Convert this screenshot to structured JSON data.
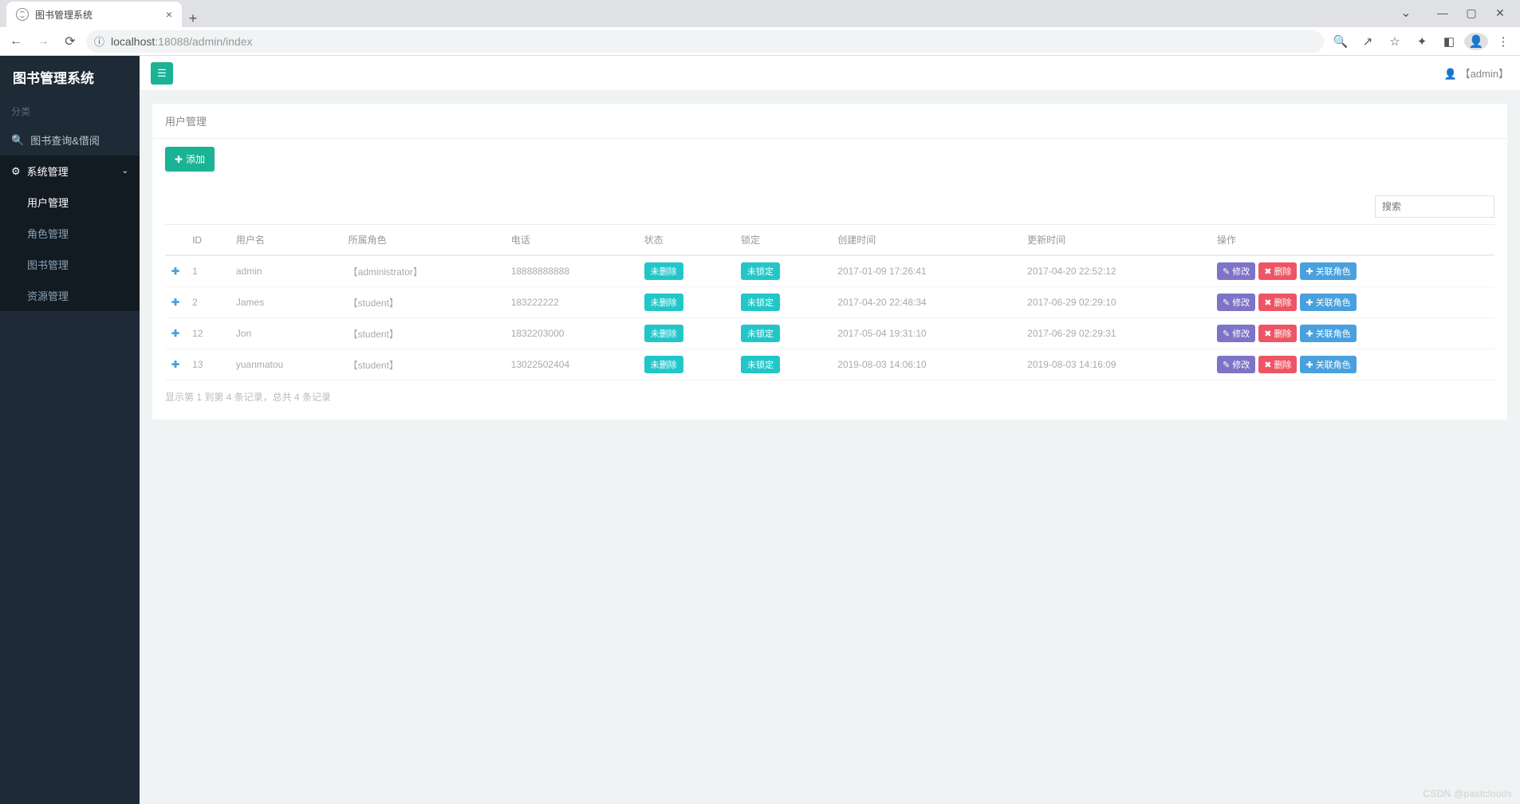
{
  "browser": {
    "tab_title": "图书管理系统",
    "url_prefix": "localhost",
    "url_port_path": ":18088/admin/index"
  },
  "brand": "图书管理系统",
  "sidebar": {
    "category_label": "分类",
    "items": [
      {
        "label": "图书查询&借阅"
      },
      {
        "label": "系统管理"
      }
    ],
    "sub": [
      {
        "label": "用户管理"
      },
      {
        "label": "角色管理"
      },
      {
        "label": "图书管理"
      },
      {
        "label": "资源管理"
      }
    ]
  },
  "header": {
    "user": "【admin】"
  },
  "panel": {
    "title": "用户管理",
    "add_label": "添加",
    "search_placeholder": "搜索",
    "columns": {
      "id": "ID",
      "username": "用户名",
      "role": "所属角色",
      "phone": "电话",
      "status": "状态",
      "lock": "锁定",
      "created": "创建时间",
      "updated": "更新时间",
      "ops": "操作"
    },
    "status_label": "未删除",
    "lock_label": "未锁定",
    "ops_edit": "修改",
    "ops_delete": "删除",
    "ops_role": "关联角色",
    "rows": [
      {
        "id": "1",
        "username": "admin",
        "role": "【administrator】",
        "phone": "18888888888",
        "created": "2017-01-09 17:26:41",
        "updated": "2017-04-20 22:52:12"
      },
      {
        "id": "2",
        "username": "James",
        "role": "【student】",
        "phone": "183222222",
        "created": "2017-04-20 22:48:34",
        "updated": "2017-06-29 02:29:10"
      },
      {
        "id": "12",
        "username": "Jon",
        "role": "【student】",
        "phone": "1832203000",
        "created": "2017-05-04 19:31:10",
        "updated": "2017-06-29 02:29:31"
      },
      {
        "id": "13",
        "username": "yuanmatou",
        "role": "【student】",
        "phone": "13022502404",
        "created": "2019-08-03 14:06:10",
        "updated": "2019-08-03 14:16:09"
      }
    ],
    "pagination_info": "显示第 1 到第 4 条记录，总共 4 条记录"
  },
  "watermark": "CSDN @pastclouds"
}
